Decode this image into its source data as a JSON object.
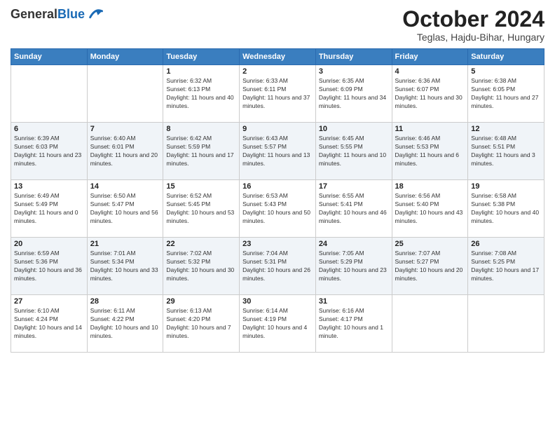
{
  "logo": {
    "general": "General",
    "blue": "Blue"
  },
  "header": {
    "month": "October 2024",
    "location": "Teglas, Hajdu-Bihar, Hungary"
  },
  "weekdays": [
    "Sunday",
    "Monday",
    "Tuesday",
    "Wednesday",
    "Thursday",
    "Friday",
    "Saturday"
  ],
  "weeks": [
    [
      {
        "day": "",
        "content": ""
      },
      {
        "day": "",
        "content": ""
      },
      {
        "day": "1",
        "content": "Sunrise: 6:32 AM\nSunset: 6:13 PM\nDaylight: 11 hours and 40 minutes."
      },
      {
        "day": "2",
        "content": "Sunrise: 6:33 AM\nSunset: 6:11 PM\nDaylight: 11 hours and 37 minutes."
      },
      {
        "day": "3",
        "content": "Sunrise: 6:35 AM\nSunset: 6:09 PM\nDaylight: 11 hours and 34 minutes."
      },
      {
        "day": "4",
        "content": "Sunrise: 6:36 AM\nSunset: 6:07 PM\nDaylight: 11 hours and 30 minutes."
      },
      {
        "day": "5",
        "content": "Sunrise: 6:38 AM\nSunset: 6:05 PM\nDaylight: 11 hours and 27 minutes."
      }
    ],
    [
      {
        "day": "6",
        "content": "Sunrise: 6:39 AM\nSunset: 6:03 PM\nDaylight: 11 hours and 23 minutes."
      },
      {
        "day": "7",
        "content": "Sunrise: 6:40 AM\nSunset: 6:01 PM\nDaylight: 11 hours and 20 minutes."
      },
      {
        "day": "8",
        "content": "Sunrise: 6:42 AM\nSunset: 5:59 PM\nDaylight: 11 hours and 17 minutes."
      },
      {
        "day": "9",
        "content": "Sunrise: 6:43 AM\nSunset: 5:57 PM\nDaylight: 11 hours and 13 minutes."
      },
      {
        "day": "10",
        "content": "Sunrise: 6:45 AM\nSunset: 5:55 PM\nDaylight: 11 hours and 10 minutes."
      },
      {
        "day": "11",
        "content": "Sunrise: 6:46 AM\nSunset: 5:53 PM\nDaylight: 11 hours and 6 minutes."
      },
      {
        "day": "12",
        "content": "Sunrise: 6:48 AM\nSunset: 5:51 PM\nDaylight: 11 hours and 3 minutes."
      }
    ],
    [
      {
        "day": "13",
        "content": "Sunrise: 6:49 AM\nSunset: 5:49 PM\nDaylight: 11 hours and 0 minutes."
      },
      {
        "day": "14",
        "content": "Sunrise: 6:50 AM\nSunset: 5:47 PM\nDaylight: 10 hours and 56 minutes."
      },
      {
        "day": "15",
        "content": "Sunrise: 6:52 AM\nSunset: 5:45 PM\nDaylight: 10 hours and 53 minutes."
      },
      {
        "day": "16",
        "content": "Sunrise: 6:53 AM\nSunset: 5:43 PM\nDaylight: 10 hours and 50 minutes."
      },
      {
        "day": "17",
        "content": "Sunrise: 6:55 AM\nSunset: 5:41 PM\nDaylight: 10 hours and 46 minutes."
      },
      {
        "day": "18",
        "content": "Sunrise: 6:56 AM\nSunset: 5:40 PM\nDaylight: 10 hours and 43 minutes."
      },
      {
        "day": "19",
        "content": "Sunrise: 6:58 AM\nSunset: 5:38 PM\nDaylight: 10 hours and 40 minutes."
      }
    ],
    [
      {
        "day": "20",
        "content": "Sunrise: 6:59 AM\nSunset: 5:36 PM\nDaylight: 10 hours and 36 minutes."
      },
      {
        "day": "21",
        "content": "Sunrise: 7:01 AM\nSunset: 5:34 PM\nDaylight: 10 hours and 33 minutes."
      },
      {
        "day": "22",
        "content": "Sunrise: 7:02 AM\nSunset: 5:32 PM\nDaylight: 10 hours and 30 minutes."
      },
      {
        "day": "23",
        "content": "Sunrise: 7:04 AM\nSunset: 5:31 PM\nDaylight: 10 hours and 26 minutes."
      },
      {
        "day": "24",
        "content": "Sunrise: 7:05 AM\nSunset: 5:29 PM\nDaylight: 10 hours and 23 minutes."
      },
      {
        "day": "25",
        "content": "Sunrise: 7:07 AM\nSunset: 5:27 PM\nDaylight: 10 hours and 20 minutes."
      },
      {
        "day": "26",
        "content": "Sunrise: 7:08 AM\nSunset: 5:25 PM\nDaylight: 10 hours and 17 minutes."
      }
    ],
    [
      {
        "day": "27",
        "content": "Sunrise: 6:10 AM\nSunset: 4:24 PM\nDaylight: 10 hours and 14 minutes."
      },
      {
        "day": "28",
        "content": "Sunrise: 6:11 AM\nSunset: 4:22 PM\nDaylight: 10 hours and 10 minutes."
      },
      {
        "day": "29",
        "content": "Sunrise: 6:13 AM\nSunset: 4:20 PM\nDaylight: 10 hours and 7 minutes."
      },
      {
        "day": "30",
        "content": "Sunrise: 6:14 AM\nSunset: 4:19 PM\nDaylight: 10 hours and 4 minutes."
      },
      {
        "day": "31",
        "content": "Sunrise: 6:16 AM\nSunset: 4:17 PM\nDaylight: 10 hours and 1 minute."
      },
      {
        "day": "",
        "content": ""
      },
      {
        "day": "",
        "content": ""
      }
    ]
  ]
}
